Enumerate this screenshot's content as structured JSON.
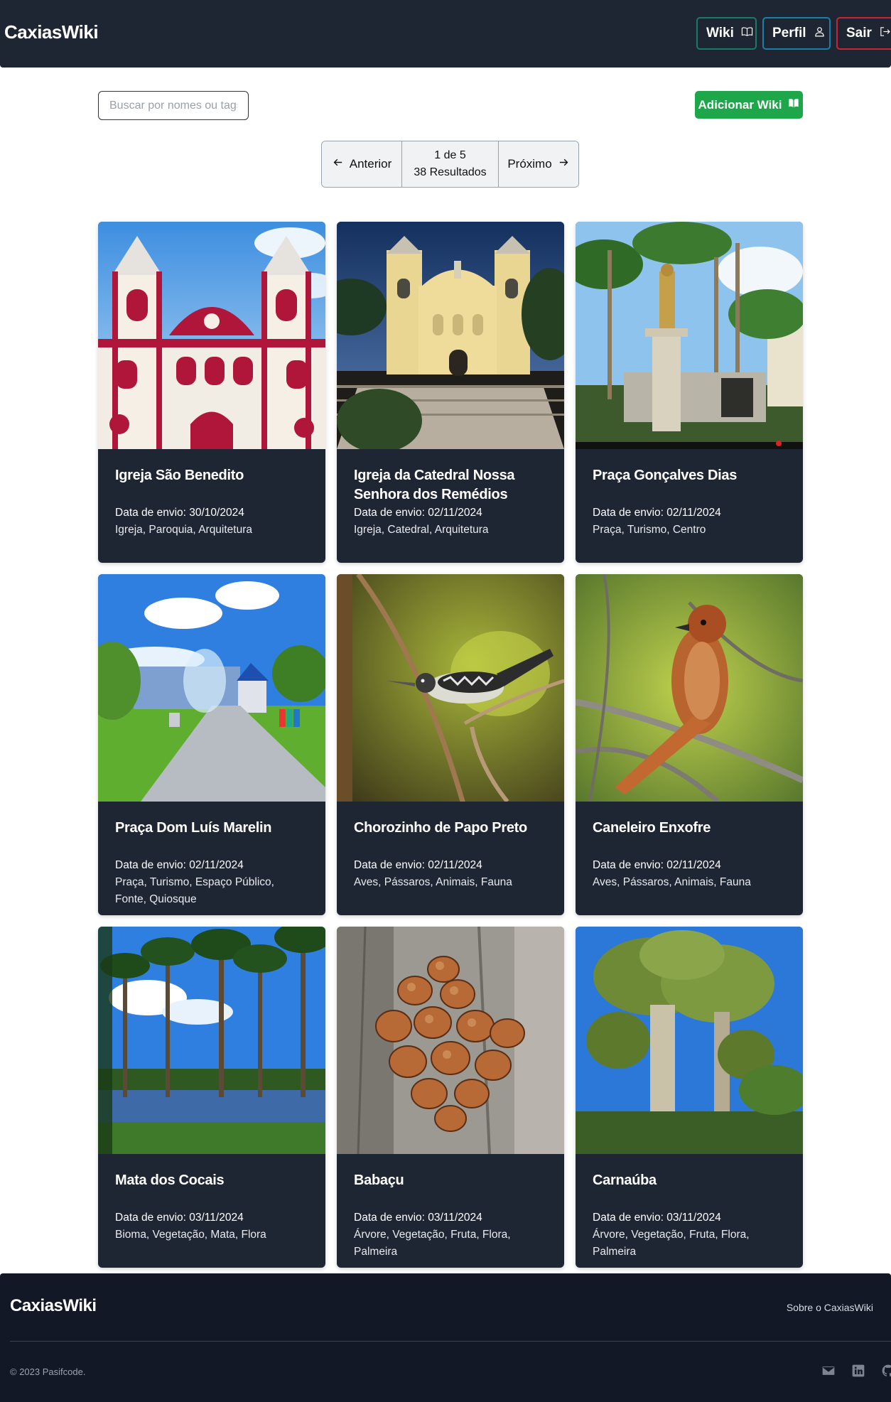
{
  "header": {
    "brand": "CaxiasWiki",
    "nav": [
      {
        "label": "Wiki",
        "icon": "book-open-icon"
      },
      {
        "label": "Perfil",
        "icon": "user-icon"
      },
      {
        "label": "Sair",
        "icon": "logout-icon"
      }
    ]
  },
  "toolbar": {
    "search_placeholder": "Buscar por nomes ou tags",
    "search_value": "",
    "add_label": "Adicionar Wiki",
    "add_icon": "book-icon"
  },
  "pagination": {
    "prev_label": "Anterior",
    "page_text": "1 de 5",
    "results_text": "38 Resultados",
    "next_label": "Próximo"
  },
  "cards": [
    {
      "title": "Igreja São Benedito",
      "date": "Data de envio: 30/10/2024",
      "tags": "Igreja, Paroquia, Arquitetura"
    },
    {
      "title": "Igreja da Catedral Nossa Senhora dos Remédios",
      "date": "Data de envio: 02/11/2024",
      "tags": "Igreja, Catedral, Arquitetura"
    },
    {
      "title": "Praça Gonçalves Dias",
      "date": "Data de envio: 02/11/2024",
      "tags": "Praça, Turismo, Centro"
    },
    {
      "title": "Praça Dom Luís Marelin",
      "date": "Data de envio: 02/11/2024",
      "tags": "Praça, Turismo, Espaço Público, Fonte, Quiosque"
    },
    {
      "title": "Chorozinho de Papo Preto",
      "date": "Data de envio: 02/11/2024",
      "tags": "Aves, Pássaros, Animais, Fauna"
    },
    {
      "title": "Caneleiro Enxofre",
      "date": "Data de envio: 02/11/2024",
      "tags": "Aves, Pássaros, Animais, Fauna"
    },
    {
      "title": "Mata dos Cocais",
      "date": "Data de envio: 03/11/2024",
      "tags": "Bioma, Vegetação, Mata, Flora"
    },
    {
      "title": "Babaçu",
      "date": "Data de envio: 03/11/2024",
      "tags": "Árvore, Vegetação, Fruta, Flora, Palmeira"
    },
    {
      "title": "Carnaúba",
      "date": "Data de envio: 03/11/2024",
      "tags": "Árvore, Vegetação, Fruta, Flora, Palmeira"
    }
  ],
  "footer": {
    "brand": "CaxiasWiki",
    "about": "Sobre o CaxiasWiki",
    "copyright": "© 2023 Pasifcode.",
    "icons": [
      "mail-icon",
      "linkedin-icon",
      "github-icon"
    ]
  },
  "colors": {
    "header_bg": "#1e2533",
    "card_bg": "#1e2533",
    "footer_bg": "#121826",
    "add_button": "#1ea64a",
    "wiki_border": "#1a7a66",
    "perfil_border": "#1d7fa5",
    "sair_border": "#c92434"
  }
}
